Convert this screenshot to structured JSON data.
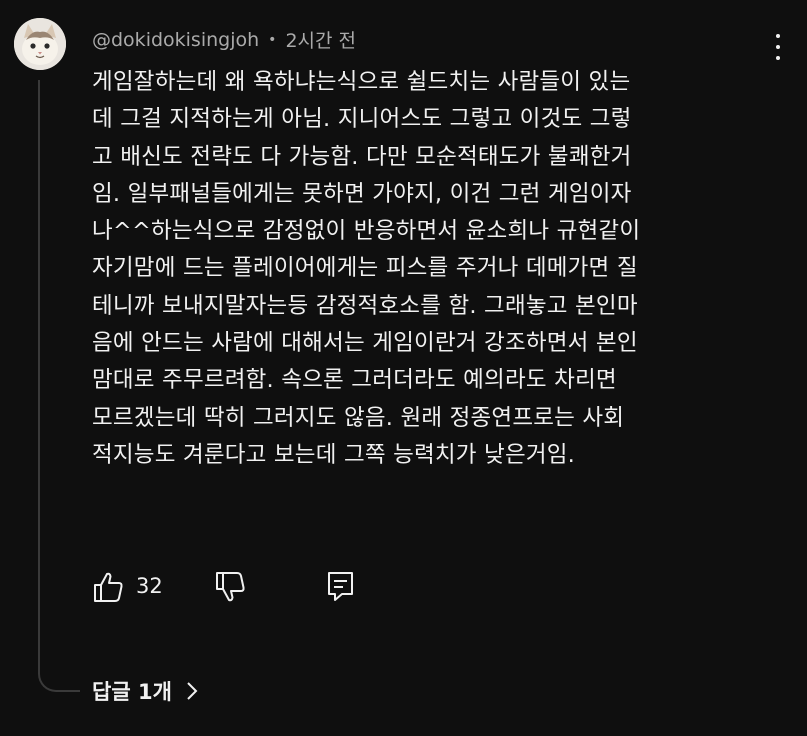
{
  "comment": {
    "author": "@dokidokisingjoh",
    "separator": "•",
    "time": "2시간 전",
    "lines": [
      "게임잘하는데 왜 욕하냐는식으로 쉴드치는 사람들이 있는",
      "데 그걸 지적하는게 아님. 지니어스도 그렇고 이것도 그렇",
      "고 배신도 전략도 다 가능함. 다만 모순적태도가 불쾌한거",
      "임. 일부패널들에게는 못하면 가야지, 이건 그런 게임이자",
      "나^^하는식으로 감정없이 반응하면서 윤소희나 규현같이",
      "자기맘에 드는 플레이어에게는 피스를 주거나 데메가면 질",
      "테니까 보내지말자는등 감정적호소를 함. 그래놓고 본인마",
      "음에 안드는 사람에 대해서는 게임이란거 강조하면서 본인",
      "맘대로 주무르려함. 속으론 그러더라도 예의라도 차리면",
      "모르겠는데 딱히 그러지도 않음. 원래 정종연프로는 사회",
      "적지능도 겨룬다고 보는데 그쪽 능력치가 낮은거임."
    ],
    "like_count": "32"
  },
  "replies": {
    "label": "답글 1개"
  },
  "icons": {
    "menu": "more-vert-icon",
    "like": "thumbs-up-icon",
    "dislike": "thumbs-down-icon",
    "reply": "reply-icon",
    "replies_chevron": "chevron-right-icon"
  },
  "colors": {
    "background": "#0f0f0f",
    "text": "#f1f1f1",
    "secondary": "#aaaaaa",
    "thread_line": "#3a3a3a"
  }
}
